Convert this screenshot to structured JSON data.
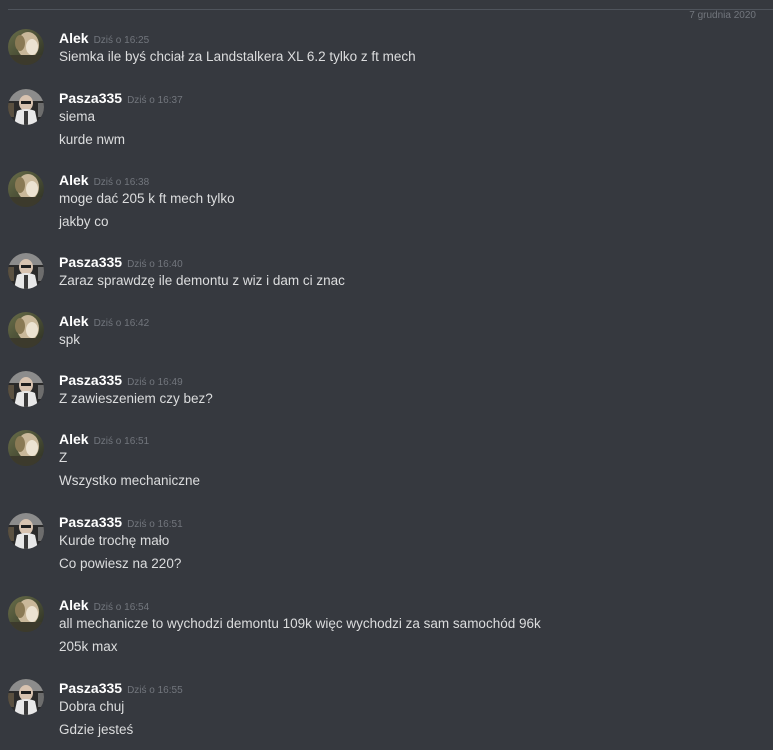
{
  "date_divider": "7 grudnia 2020",
  "messages": [
    {
      "author": "Alek",
      "time": "Dziś o 16:25",
      "lines": [
        "Siemka ile byś chciał za Landstalkera XL 6.2 tylko z ft mech"
      ]
    },
    {
      "author": "Pasza335",
      "time": "Dziś o 16:37",
      "lines": [
        "siema",
        "kurde nwm"
      ]
    },
    {
      "author": "Alek",
      "time": "Dziś o 16:38",
      "lines": [
        "moge dać 205 k ft mech tylko",
        "jakby co"
      ]
    },
    {
      "author": "Pasza335",
      "time": "Dziś o 16:40",
      "lines": [
        "Zaraz sprawdzę ile demontu z wiz i dam ci znac"
      ]
    },
    {
      "author": "Alek",
      "time": "Dziś o 16:42",
      "lines": [
        "spk"
      ]
    },
    {
      "author": "Pasza335",
      "time": "Dziś o 16:49",
      "lines": [
        "Z zawieszeniem czy bez?"
      ]
    },
    {
      "author": "Alek",
      "time": "Dziś o 16:51",
      "lines": [
        "Z",
        "Wszystko mechaniczne"
      ]
    },
    {
      "author": "Pasza335",
      "time": "Dziś o 16:51",
      "lines": [
        "Kurde trochę mało",
        "Co powiesz na 220?"
      ]
    },
    {
      "author": "Alek",
      "time": "Dziś o 16:54",
      "lines": [
        "all mechanicze to wychodzi demontu 109k więc wychodzi za sam samochód 96k",
        "205k max"
      ]
    },
    {
      "author": "Pasza335",
      "time": "Dziś o 16:55",
      "lines": [
        "Dobra chuj",
        "Gdzie jesteś"
      ]
    }
  ],
  "colors": {
    "background": "#36393f",
    "username": "#ffffff",
    "timestamp": "#72767d",
    "text": "#dcddde",
    "divider": "#4f545c"
  }
}
